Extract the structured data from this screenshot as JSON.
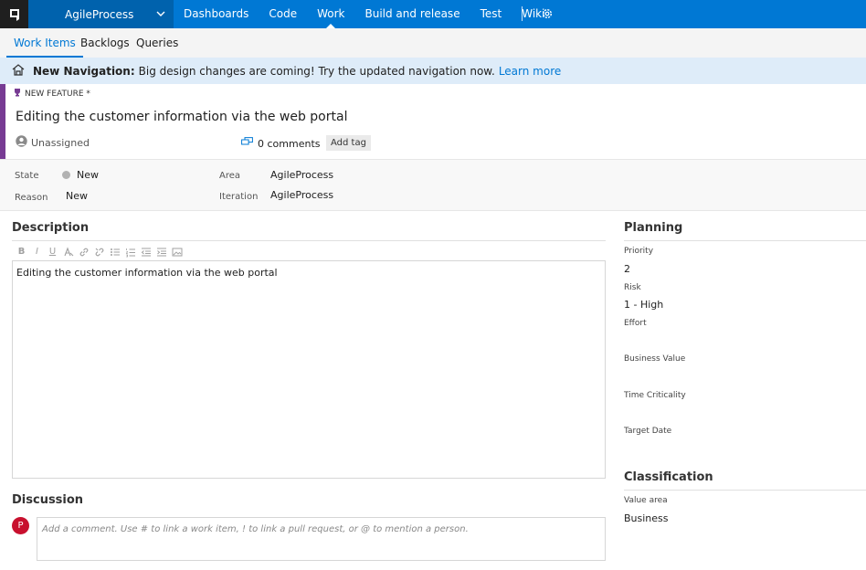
{
  "topbar": {
    "project": "AgileProcess",
    "nav": [
      "Dashboards",
      "Code",
      "Work",
      "Build and release",
      "Test",
      "Wiki"
    ],
    "active_nav": "Work",
    "icons": {
      "logo": "vsts-logo-icon",
      "chevron": "chevron-down-icon",
      "settings": "gear-icon"
    }
  },
  "subnav": {
    "tabs": [
      "Work Items",
      "Backlogs",
      "Queries"
    ],
    "active": "Work Items"
  },
  "banner": {
    "bold": "New Navigation:",
    "text": "Big design changes are coming! Try the updated navigation now.",
    "link": "Learn more",
    "icon": "new-navigation-icon"
  },
  "workitem": {
    "type": "NEW FEATURE *",
    "type_icon": "trophy-icon",
    "title": "Editing the customer information via the web portal",
    "assignee": "Unassigned",
    "comments": "0 comments",
    "add_tag": "Add tag",
    "accent_color": "#773b93"
  },
  "fields": {
    "state_label": "State",
    "state_value": "New",
    "reason_label": "Reason",
    "reason_value": "New",
    "area_label": "Area",
    "area_value": "AgileProcess",
    "iteration_label": "Iteration",
    "iteration_value": "AgileProcess"
  },
  "description": {
    "heading": "Description",
    "text": "Editing the customer information via the web portal",
    "toolbar": [
      "bold-icon",
      "italic-icon",
      "underline-icon",
      "highlight-icon",
      "link-icon",
      "unlink-icon",
      "bullet-list-icon",
      "numbered-list-icon",
      "outdent-icon",
      "indent-icon",
      "image-icon"
    ]
  },
  "discussion": {
    "heading": "Discussion",
    "avatar": "P",
    "placeholder": "Add a comment. Use # to link a work item, ! to link a pull request, or @ to mention a person."
  },
  "planning": {
    "heading": "Planning",
    "priority_label": "Priority",
    "priority_value": "2",
    "risk_label": "Risk",
    "risk_value": "1 - High",
    "effort_label": "Effort",
    "business_value_label": "Business Value",
    "time_criticality_label": "Time Criticality",
    "target_date_label": "Target Date"
  },
  "classification": {
    "heading": "Classification",
    "value_area_label": "Value area",
    "value_area_value": "Business"
  }
}
